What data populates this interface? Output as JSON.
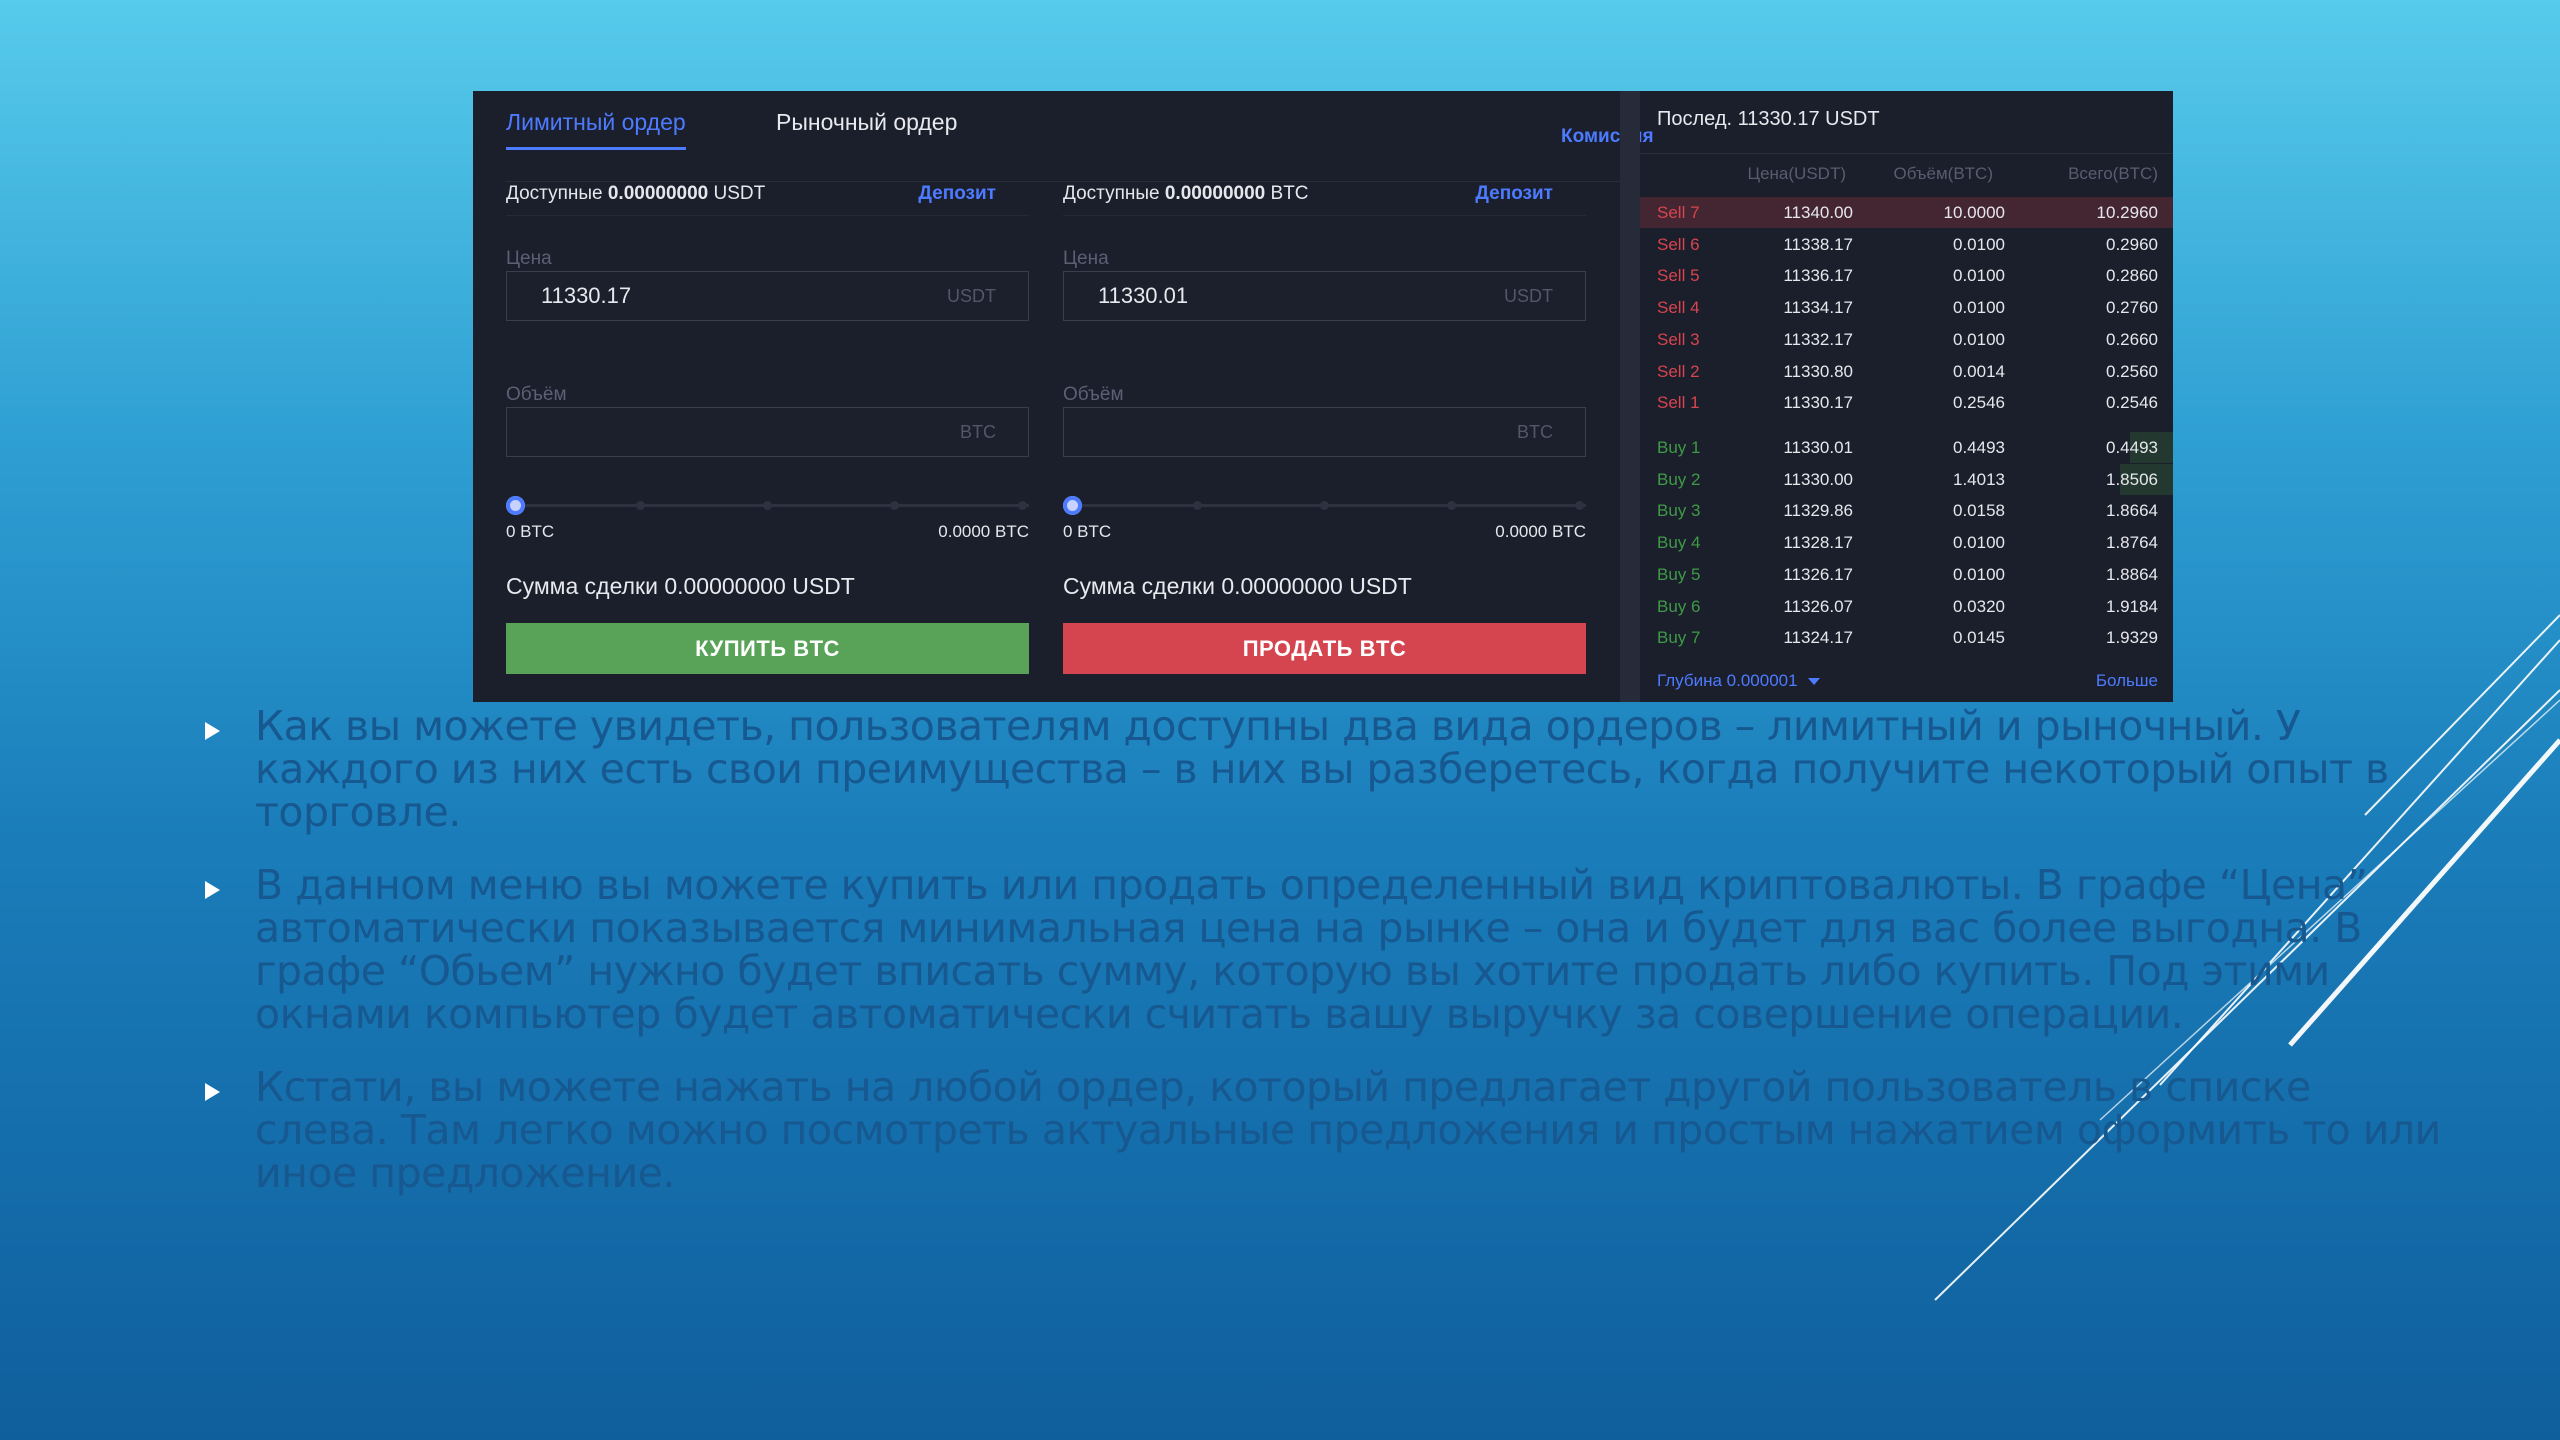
{
  "trade_panel": {
    "tabs": {
      "limit": "Лимитный ордер",
      "market": "Рыночный ордер",
      "commission": "Комиссия"
    },
    "buy": {
      "available_prefix": "Доступные",
      "available_amount": "0.00000000",
      "available_unit": "USDT",
      "deposit": "Депозит",
      "price_label": "Цена",
      "price_value": "11330.17",
      "price_unit": "USDT",
      "volume_label": "Объём",
      "volume_value": "",
      "volume_unit": "BTC",
      "slider_min": "0 BTC",
      "slider_max": "0.0000 BTC",
      "total": "Сумма сделки 0.00000000 USDT",
      "button": "КУПИТЬ BTC"
    },
    "sell": {
      "available_prefix": "Доступные",
      "available_amount": "0.00000000",
      "available_unit": "BTC",
      "deposit": "Депозит",
      "price_label": "Цена",
      "price_value": "11330.01",
      "price_unit": "USDT",
      "volume_label": "Объём",
      "volume_value": "",
      "volume_unit": "BTC",
      "slider_min": "0 BTC",
      "slider_max": "0.0000 BTC",
      "total": "Сумма сделки 0.00000000 USDT",
      "button": "ПРОДАТЬ BTC"
    },
    "colors": {
      "accent": "#4d7bff",
      "buy": "#58a357",
      "sell": "#d5454f",
      "panel": "#1b1e2b"
    }
  },
  "order_book": {
    "last": "Послед. 11330.17 USDT",
    "headers": {
      "price": "Цена(USDT)",
      "volume": "Объём(BTC)",
      "total": "Всего(BTC)"
    },
    "sells": [
      {
        "label": "Sell 7",
        "price": "11340.00",
        "volume": "10.0000",
        "total": "10.2960",
        "depth": 1.0
      },
      {
        "label": "Sell 6",
        "price": "11338.17",
        "volume": "0.0100",
        "total": "0.2960",
        "depth": 0.0
      },
      {
        "label": "Sell 5",
        "price": "11336.17",
        "volume": "0.0100",
        "total": "0.2860",
        "depth": 0.0
      },
      {
        "label": "Sell 4",
        "price": "11334.17",
        "volume": "0.0100",
        "total": "0.2760",
        "depth": 0.0
      },
      {
        "label": "Sell 3",
        "price": "11332.17",
        "volume": "0.0100",
        "total": "0.2660",
        "depth": 0.0
      },
      {
        "label": "Sell 2",
        "price": "11330.80",
        "volume": "0.0014",
        "total": "0.2560",
        "depth": 0.0
      },
      {
        "label": "Sell 1",
        "price": "11330.17",
        "volume": "0.2546",
        "total": "0.2546",
        "depth": 0.0
      }
    ],
    "buys": [
      {
        "label": "Buy 1",
        "price": "11330.01",
        "volume": "0.4493",
        "total": "0.4493",
        "depth": 0.08
      },
      {
        "label": "Buy 2",
        "price": "11330.00",
        "volume": "1.4013",
        "total": "1.8506",
        "depth": 0.1
      },
      {
        "label": "Buy 3",
        "price": "11329.86",
        "volume": "0.0158",
        "total": "1.8664",
        "depth": 0.0
      },
      {
        "label": "Buy 4",
        "price": "11328.17",
        "volume": "0.0100",
        "total": "1.8764",
        "depth": 0.0
      },
      {
        "label": "Buy 5",
        "price": "11326.17",
        "volume": "0.0100",
        "total": "1.8864",
        "depth": 0.0
      },
      {
        "label": "Buy 6",
        "price": "11326.07",
        "volume": "0.0320",
        "total": "1.9184",
        "depth": 0.0
      },
      {
        "label": "Buy 7",
        "price": "11324.17",
        "volume": "0.0145",
        "total": "1.9329",
        "depth": 0.0
      }
    ],
    "depth_label": "Глубина 0.000001",
    "more": "Больше"
  },
  "slide": {
    "bullets": [
      "Как вы можете увидеть, пользователям доступны два вида ордеров – лимитный и рыночный. У каждого из них есть свои преимущества – в них вы разберетесь, когда получите некоторый опыт в торговле.",
      "В данном меню вы можете купить или продать определенный вид криптовалюты. В графе “Цена” автоматически показывается минимальная цена на рынке – она и будет для вас более выгодна. В графе “Обьем” нужно будет вписать сумму, которую вы хотите продать либо купить. Под этими окнами компьютер будет автоматически считать вашу выручку за совершение операции.",
      "Кстати, вы можете нажать на любой ордер, который предлагает другой пользователь в списке слева. Там легко можно посмотреть актуальные предложения и простым нажатием оформить то или иное предложение."
    ],
    "colors": {
      "text": "#16588f",
      "bullet_marker": "#ffffff"
    }
  }
}
